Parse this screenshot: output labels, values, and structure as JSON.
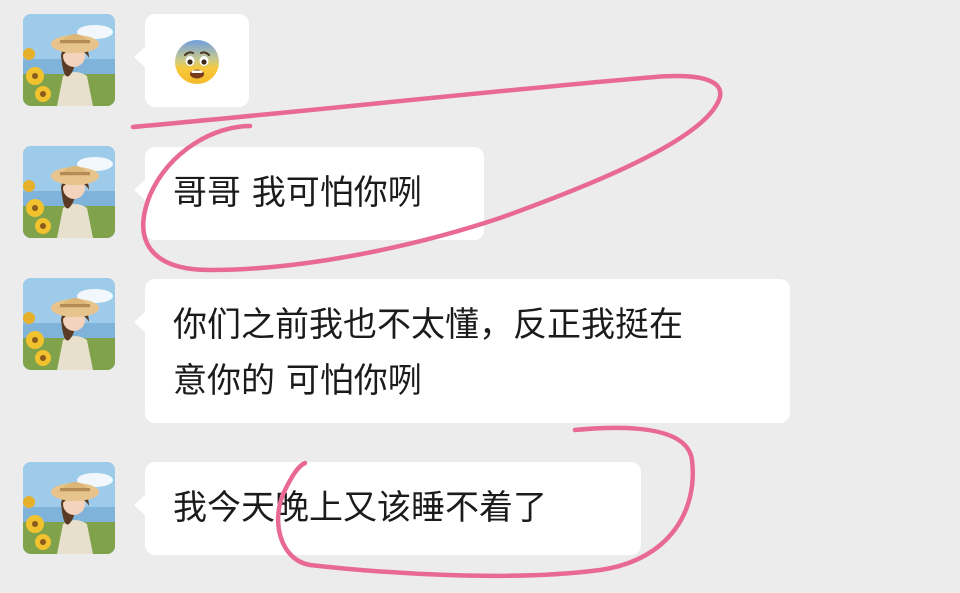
{
  "messages": [
    {
      "type": "emoji",
      "emoji": "fearful-face-emoji"
    },
    {
      "type": "text",
      "lines": [
        "哥哥 我可怕你咧"
      ]
    },
    {
      "type": "text",
      "lines": [
        "你们之前我也不太懂，反正我挺在",
        "意你的 可怕你咧"
      ]
    },
    {
      "type": "text",
      "lines": [
        "我今天晚上又该睡不着了"
      ]
    }
  ],
  "colors": {
    "background": "#ececec",
    "bubble": "#ffffff",
    "text": "#1b1b1b",
    "annotation": "#e86a93"
  }
}
